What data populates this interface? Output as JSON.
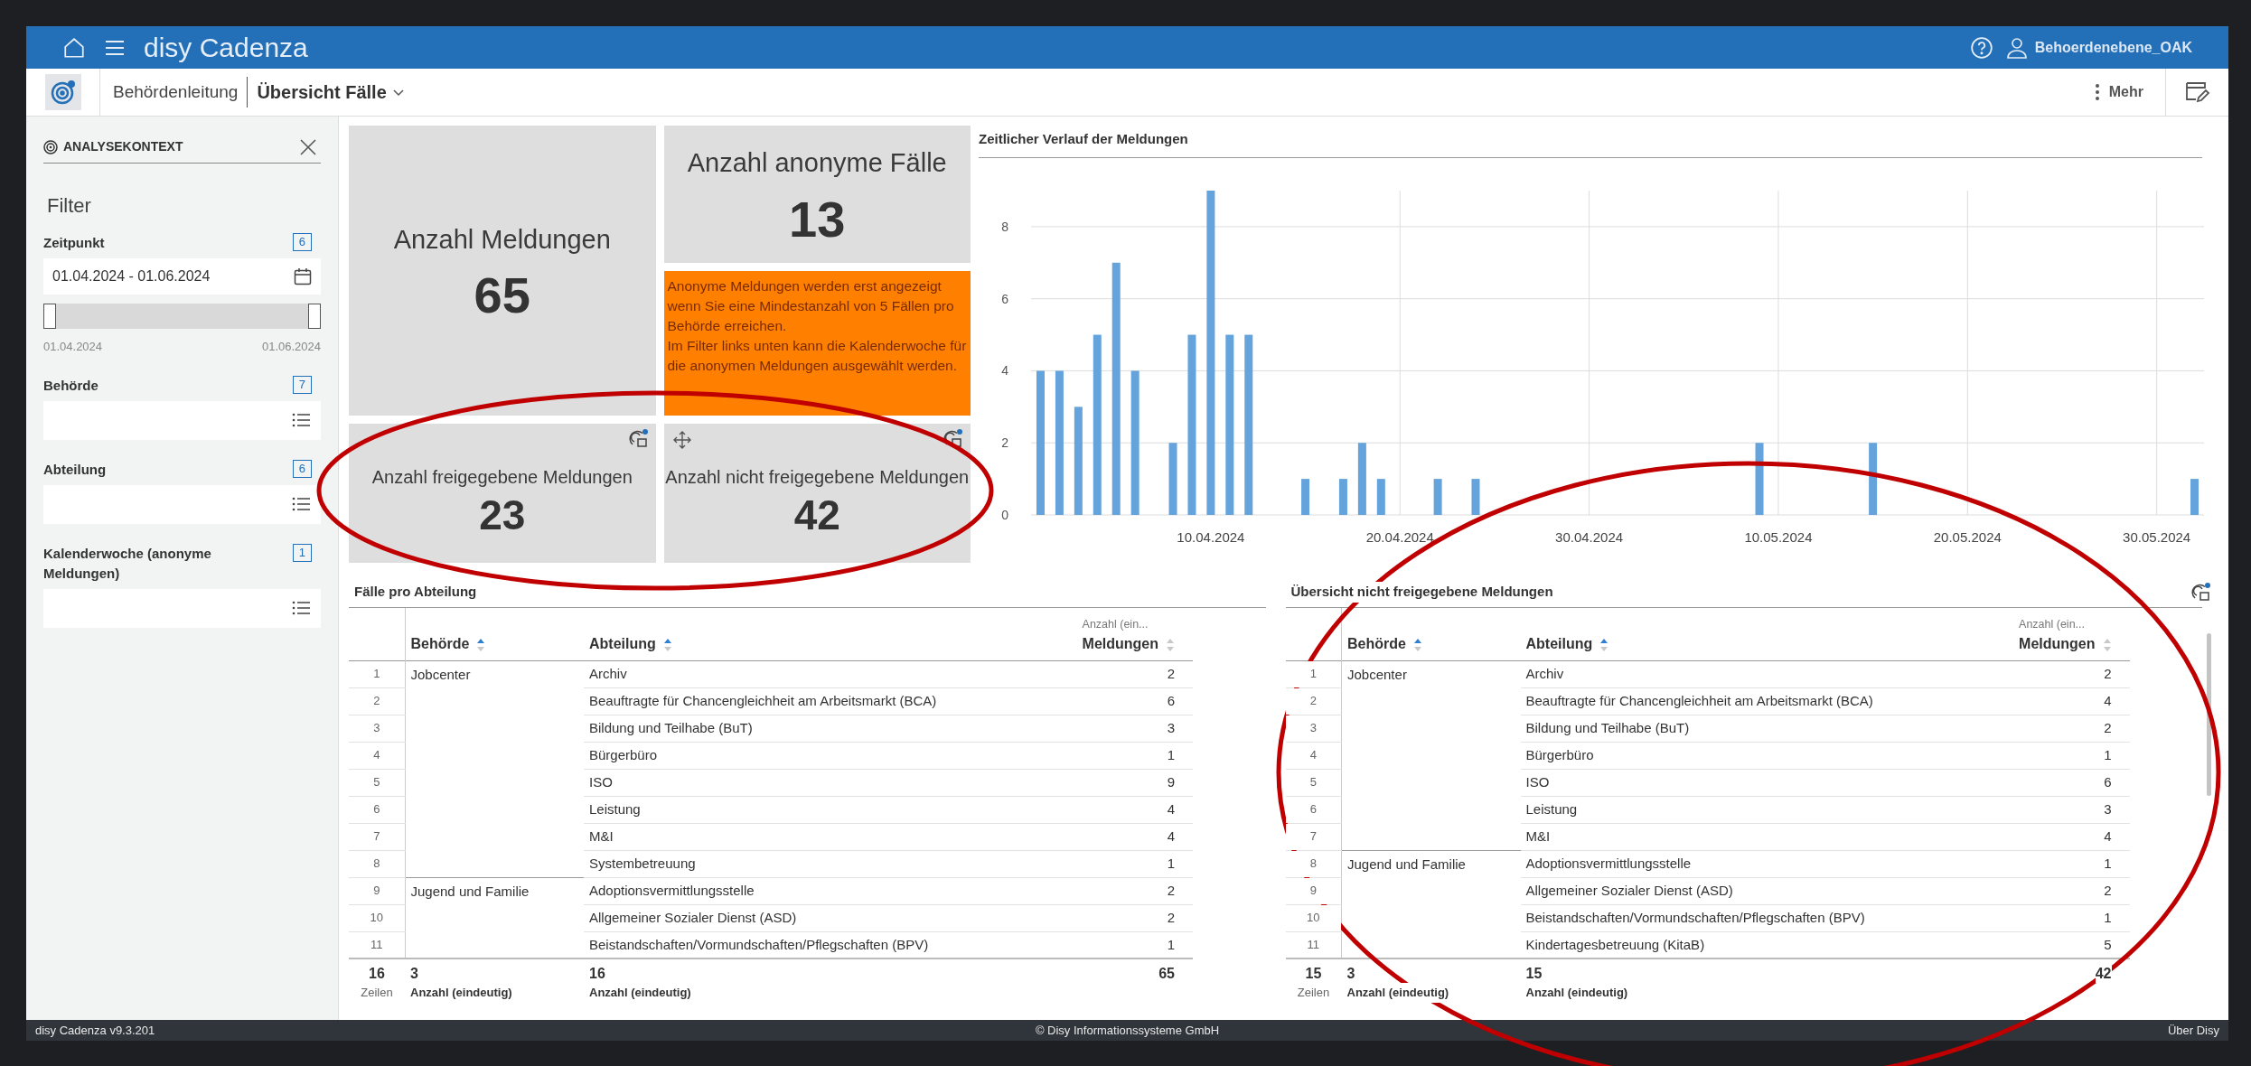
{
  "app_bar": {
    "title": "disy Cadenza",
    "user": "Behoerdenebene_OAK"
  },
  "breadcrumb": {
    "section": "Behördenleitung",
    "page": "Übersicht Fälle",
    "more": "Mehr"
  },
  "sidebar": {
    "title": "ANALYSEKONTEXT",
    "heading": "Filter",
    "filters": [
      {
        "kind": "date",
        "label": "Zeitpunkt",
        "count": "6",
        "value": "01.04.2024 - 01.06.2024",
        "slider": {
          "thumbs": [
            {
              "level": 0
            },
            {
              "level": 1
            }
          ],
          "min_label": "01.04.2024",
          "max_label": "01.06.2024"
        }
      },
      {
        "kind": "list",
        "label": "Behörde",
        "count": "7"
      },
      {
        "kind": "list",
        "label": "Abteilung",
        "count": "6"
      },
      {
        "kind": "list",
        "label": "Kalenderwoche (anonyme Meldungen)",
        "count": "1"
      }
    ]
  },
  "kpis": [
    {
      "title": "Anzahl Meldungen",
      "value": "65"
    },
    {
      "title": "Anzahl freigegebene Meldungen",
      "value": "23",
      "filter_indicator": true
    },
    {
      "title": "Anzahl anonyme Fälle",
      "value": "13"
    },
    {
      "title": "Anzahl nicht freigegebene Meldungen",
      "value": "42",
      "filter_indicator": true,
      "move_handle": true
    }
  ],
  "notice": [
    "Anonyme Meldungen werden erst angezeigt wenn Sie eine Mindestanzahl von 5 Fällen pro Behörde erreichen.",
    "Im Filter links unten kann die Kalenderwoche für die anonymen Meldungen ausgewählt werden."
  ],
  "timeline": {
    "title": "Zeitlicher Verlauf der Meldungen",
    "chart_data": {
      "type": "bar",
      "grid": true,
      "categories": [
        null,
        null,
        null,
        null,
        null,
        null,
        null,
        null,
        null,
        "10.04.2024",
        null,
        null,
        null,
        null,
        null,
        null,
        null,
        null,
        null,
        "20.04.2024",
        null,
        null,
        null,
        null,
        null,
        null,
        null,
        null,
        null,
        "30.04.2024",
        null,
        null,
        null,
        null,
        null,
        null,
        null,
        null,
        null,
        "10.05.2024",
        null,
        null,
        null,
        null,
        null,
        null,
        null,
        null,
        null,
        "20.05.2024",
        null,
        null,
        null,
        null,
        null,
        null,
        null,
        null,
        null,
        "30.05.2024",
        null,
        null
      ],
      "values": [
        4,
        4,
        3,
        5,
        7,
        4,
        null,
        2,
        5,
        9,
        5,
        5,
        null,
        null,
        1,
        null,
        1,
        2,
        1,
        null,
        null,
        1,
        null,
        1,
        null,
        null,
        null,
        null,
        null,
        null,
        null,
        null,
        null,
        null,
        null,
        null,
        null,
        null,
        2,
        null,
        null,
        null,
        null,
        null,
        2,
        null,
        null,
        null,
        null,
        null,
        null,
        null,
        null,
        null,
        null,
        null,
        null,
        null,
        null,
        null,
        null,
        1
      ],
      "ylim": [
        0,
        9
      ],
      "yticks": [
        0,
        2,
        4,
        6,
        8
      ]
    }
  },
  "tables": [
    {
      "title": "Fälle pro Abteilung",
      "columns": [
        {
          "label": "Behörde",
          "sorted": true
        },
        {
          "label": "Abteilung",
          "sorted": true
        },
        {
          "label": "Meldungen",
          "supertitle": "Anzahl (ein...",
          "sorted": false
        }
      ],
      "groups": [
        {
          "behoerde": "Jobcenter",
          "rows": [
            {
              "n": "1",
              "abteilung": "Archiv",
              "value": "2"
            },
            {
              "n": "2",
              "abteilung": "Beauftragte für Chancengleichheit am Arbeitsmarkt (BCA)",
              "value": "6"
            },
            {
              "n": "3",
              "abteilung": "Bildung und Teilhabe (BuT)",
              "value": "3"
            },
            {
              "n": "4",
              "abteilung": "Bürgerbüro",
              "value": "1"
            },
            {
              "n": "5",
              "abteilung": "ISO",
              "value": "9"
            },
            {
              "n": "6",
              "abteilung": "Leistung",
              "value": "4"
            },
            {
              "n": "7",
              "abteilung": "M&I",
              "value": "4"
            },
            {
              "n": "8",
              "abteilung": "Systembetreuung",
              "value": "1"
            }
          ]
        },
        {
          "behoerde": "Jugend und Familie",
          "rows": [
            {
              "n": "9",
              "abteilung": "Adoptionsvermittlungsstelle",
              "value": "2"
            },
            {
              "n": "10",
              "abteilung": "Allgemeiner Sozialer Dienst (ASD)",
              "value": "2"
            },
            {
              "n": "11",
              "abteilung": "Beistandschaften/Vormundschaften/Pflegschaften (BPV)",
              "value": "1"
            }
          ]
        }
      ],
      "footer": {
        "rows": "16",
        "rows_label": "Zeilen",
        "behoerde": "3",
        "behoerde_label": "Anzahl (eindeutig)",
        "abteilung": "16",
        "abteilung_label": "Anzahl (eindeutig)",
        "total": "65"
      }
    },
    {
      "title": "Übersicht nicht freigegebene Meldungen",
      "filter_indicator": true,
      "scrollbar": true,
      "columns": [
        {
          "label": "Behörde",
          "sorted": true
        },
        {
          "label": "Abteilung",
          "sorted": true
        },
        {
          "label": "Meldungen",
          "supertitle": "Anzahl (ein...",
          "sorted": false
        }
      ],
      "groups": [
        {
          "behoerde": "Jobcenter",
          "rows": [
            {
              "n": "1",
              "abteilung": "Archiv",
              "value": "2"
            },
            {
              "n": "2",
              "abteilung": "Beauftragte für Chancengleichheit am Arbeitsmarkt (BCA)",
              "value": "4"
            },
            {
              "n": "3",
              "abteilung": "Bildung und Teilhabe (BuT)",
              "value": "2"
            },
            {
              "n": "4",
              "abteilung": "Bürgerbüro",
              "value": "1"
            },
            {
              "n": "5",
              "abteilung": "ISO",
              "value": "6"
            },
            {
              "n": "6",
              "abteilung": "Leistung",
              "value": "3"
            },
            {
              "n": "7",
              "abteilung": "M&I",
              "value": "4"
            }
          ]
        },
        {
          "behoerde": "Jugend und Familie",
          "rows": [
            {
              "n": "8",
              "abteilung": "Adoptionsvermittlungsstelle",
              "value": "1"
            },
            {
              "n": "9",
              "abteilung": "Allgemeiner Sozialer Dienst (ASD)",
              "value": "2"
            },
            {
              "n": "10",
              "abteilung": "Beistandschaften/Vormundschaften/Pflegschaften (BPV)",
              "value": "1"
            },
            {
              "n": "11",
              "abteilung": "Kindertagesbetreuung (KitaB)",
              "value": "5"
            }
          ]
        }
      ],
      "footer": {
        "rows": "15",
        "rows_label": "Zeilen",
        "behoerde": "3",
        "behoerde_label": "Anzahl (eindeutig)",
        "abteilung": "15",
        "abteilung_label": "Anzahl (eindeutig)",
        "total": "42"
      }
    }
  ],
  "status_bar": {
    "version": "disy Cadenza v9.3.201",
    "copyright": "© Disy Informationssysteme GmbH",
    "link": "Über Disy"
  },
  "annotations": [
    {
      "kind": "ellipse"
    },
    {
      "kind": "ellipse"
    }
  ]
}
